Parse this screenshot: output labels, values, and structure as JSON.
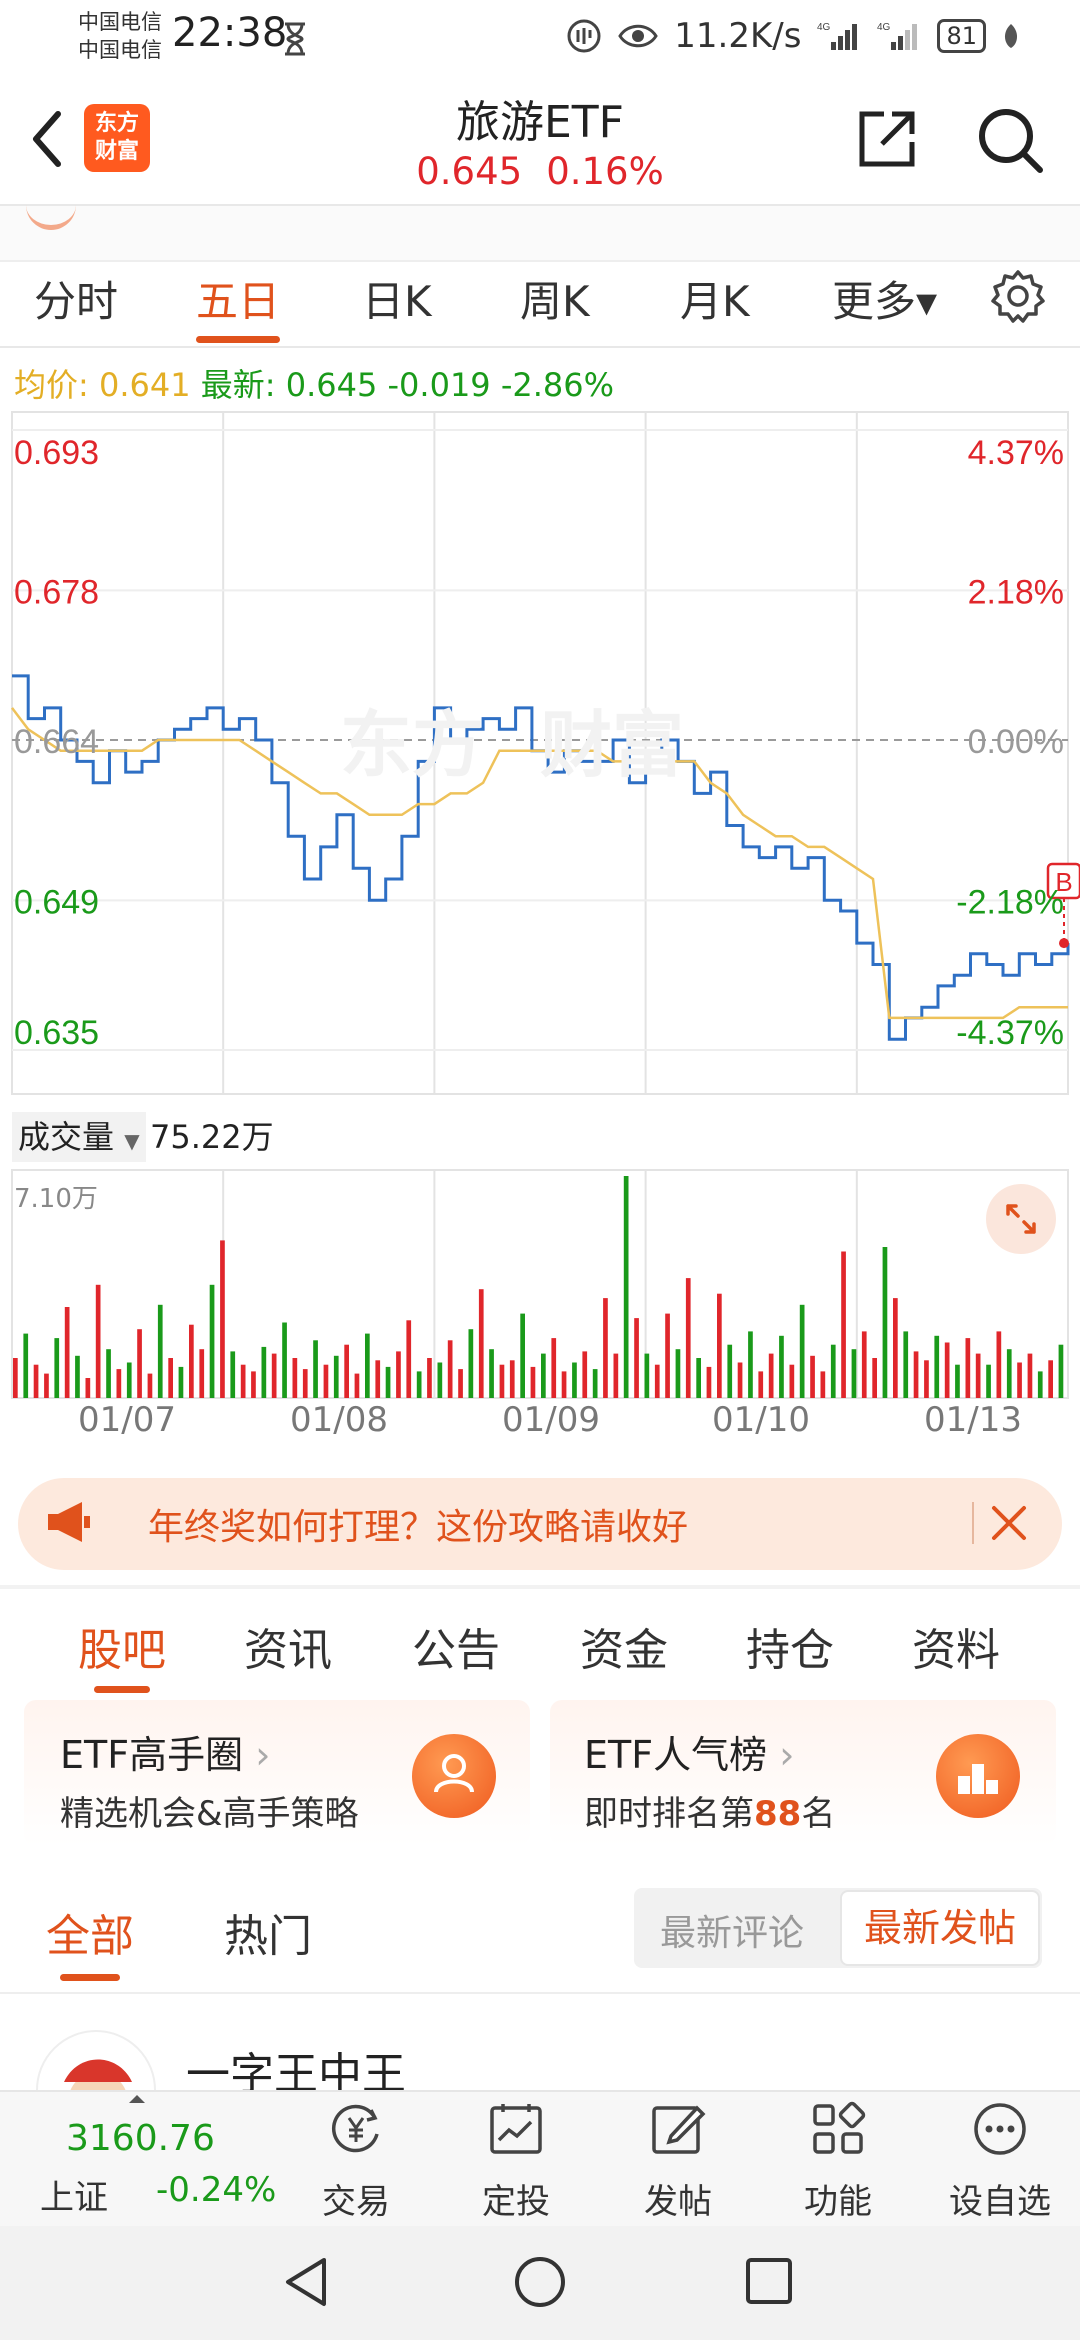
{
  "status_bar": {
    "carrier_1": "中国电信",
    "carrier_2": "中国电信",
    "time": "22:38",
    "speed": "11.2K/s",
    "battery": "81"
  },
  "header": {
    "logo_line1": "东方",
    "logo_line2": "财富",
    "title": "旅游ETF",
    "price": "0.645",
    "change_pct": "0.16%"
  },
  "chart_tabs": [
    "分时",
    "五日",
    "日K",
    "周K",
    "月K",
    "更多▾"
  ],
  "active_tab": "五日",
  "avg_row": {
    "avg_label": "均价:",
    "avg_value": "0.641",
    "latest_label": "最新:",
    "latest_value": "0.645",
    "change": "-0.019",
    "change_pct": "-2.86%"
  },
  "colors": {
    "accent": "#e0521c",
    "up": "#e0262b",
    "down": "#1a9a1a",
    "avg_line": "#eec25a",
    "price_line": "#2e6fc4"
  },
  "chart_data": {
    "type": "line",
    "title": "",
    "x_dates": [
      "01/07",
      "01/08",
      "01/09",
      "01/10",
      "01/13"
    ],
    "y_left_ticks": [
      "0.693",
      "0.678",
      "0.664",
      "0.649",
      "0.635"
    ],
    "y_right_ticks": [
      "4.37%",
      "2.18%",
      "0.00%",
      "-2.18%",
      "-4.37%"
    ],
    "ylim": [
      0.635,
      0.693
    ],
    "prev_close": 0.664,
    "marker_label": "B",
    "series": [
      {
        "values": [
          0.67,
          0.666,
          0.667,
          0.664,
          0.662,
          0.66,
          0.663,
          0.661,
          0.662,
          0.664,
          0.665,
          0.666,
          0.667,
          0.665,
          0.666,
          0.664,
          0.66,
          0.655,
          0.651,
          0.654,
          0.657,
          0.652,
          0.649,
          0.651,
          0.655,
          0.662,
          0.667,
          0.664,
          0.665,
          0.666,
          0.665,
          0.667,
          0.663,
          0.661,
          0.663,
          0.662,
          0.662,
          0.664,
          0.66,
          0.663,
          0.664,
          0.662,
          0.659,
          0.661,
          0.656,
          0.654,
          0.653,
          0.654,
          0.652,
          0.653,
          0.649,
          0.648,
          0.645,
          0.643,
          0.636,
          0.638,
          0.639,
          0.641,
          0.642,
          0.644,
          0.643,
          0.642,
          0.644,
          0.643,
          0.644,
          0.645
        ]
      },
      {
        "values": [
          0.667,
          0.665,
          0.664,
          0.663,
          0.663,
          0.663,
          0.663,
          0.663,
          0.663,
          0.664,
          0.664,
          0.664,
          0.664,
          0.664,
          0.664,
          0.663,
          0.662,
          0.661,
          0.66,
          0.659,
          0.659,
          0.658,
          0.657,
          0.657,
          0.657,
          0.658,
          0.658,
          0.659,
          0.659,
          0.66,
          0.663,
          0.663,
          0.663,
          0.663,
          0.663,
          0.663,
          0.663,
          0.662,
          0.662,
          0.662,
          0.662,
          0.662,
          0.662,
          0.66,
          0.659,
          0.657,
          0.656,
          0.655,
          0.655,
          0.654,
          0.654,
          0.653,
          0.652,
          0.651,
          0.638,
          0.638,
          0.638,
          0.638,
          0.638,
          0.638,
          0.638,
          0.638,
          0.639,
          0.639,
          0.639,
          0.639
        ]
      }
    ]
  },
  "volume": {
    "label": "成交量",
    "total": "75.22万",
    "max": "7.10万",
    "values": [
      0.18,
      0.29,
      0.15,
      0.11,
      0.27,
      0.41,
      0.19,
      0.09,
      0.51,
      0.22,
      0.13,
      0.16,
      0.31,
      0.11,
      0.42,
      0.18,
      0.14,
      0.33,
      0.22,
      0.51,
      0.71,
      0.21,
      0.15,
      0.12,
      0.23,
      0.2,
      0.34,
      0.18,
      0.13,
      0.26,
      0.15,
      0.19,
      0.24,
      0.11,
      0.29,
      0.17,
      0.14,
      0.21,
      0.35,
      0.12,
      0.18,
      0.16,
      0.26,
      0.13,
      0.31,
      0.49,
      0.22,
      0.15,
      0.17,
      0.38,
      0.14,
      0.2,
      0.27,
      0.12,
      0.16,
      0.21,
      0.13,
      0.45,
      0.2,
      1.0,
      0.36,
      0.2,
      0.15,
      0.38,
      0.22,
      0.54,
      0.18,
      0.14,
      0.47,
      0.24,
      0.16,
      0.3,
      0.12,
      0.2,
      0.28,
      0.15,
      0.42,
      0.19,
      0.12,
      0.24,
      0.66,
      0.22,
      0.3,
      0.18,
      0.68,
      0.45,
      0.3,
      0.21,
      0.17,
      0.28,
      0.25,
      0.15,
      0.27,
      0.2,
      0.15,
      0.3,
      0.22,
      0.16,
      0.2,
      0.12,
      0.17,
      0.24
    ]
  },
  "banner": {
    "text": "年终奖如何打理？这份攻略请收好"
  },
  "feature_tabs": [
    "股吧",
    "资讯",
    "公告",
    "资金",
    "持仓",
    "资料"
  ],
  "cards": [
    {
      "title": "ETF高手圈",
      "subtitle": "精选机会&高手策略"
    },
    {
      "title": "ETF人气榜",
      "sub_prefix": "即时排名第",
      "rank": "88",
      "sub_suffix": "名"
    }
  ],
  "sub_tabs": [
    "全部",
    "热门"
  ],
  "sort": {
    "latest_comment": "最新评论",
    "latest_post": "最新发帖"
  },
  "post": {
    "username": "一字王中王"
  },
  "index": {
    "name": "上证",
    "value": "3160.76",
    "change": "-0.24%"
  },
  "bottom_nav": [
    "交易",
    "定投",
    "发帖",
    "功能",
    "设自选"
  ]
}
